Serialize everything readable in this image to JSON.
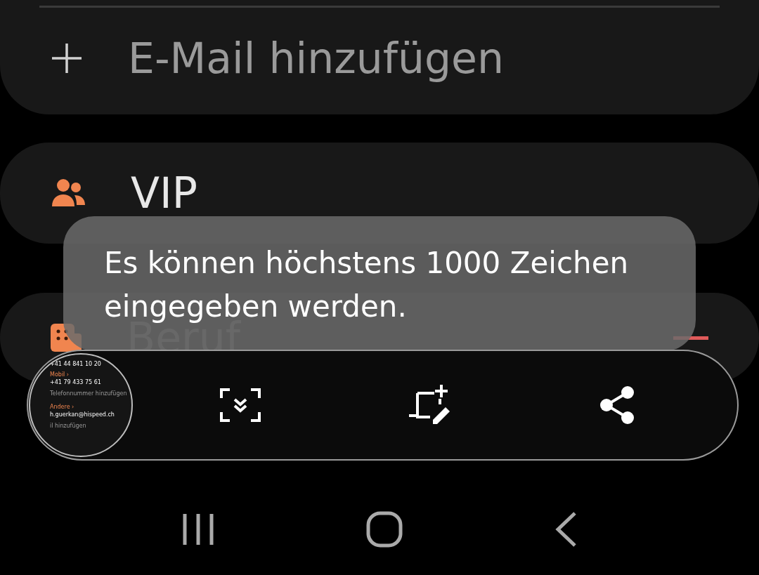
{
  "cards": [
    {
      "kind": "add",
      "label": "E-Mail hinzufügen",
      "divider": true
    },
    {
      "kind": "group",
      "label": "VIP"
    },
    {
      "kind": "work",
      "label": "Beruf"
    }
  ],
  "toast": {
    "text": "Es können höchstens 1000 Zeichen eingegeben werden."
  },
  "screenshot_preview": {
    "rows": [
      {
        "kind": "value",
        "text": "+41 44 841 10 20"
      },
      {
        "kind": "label",
        "text": "Mobil ›"
      },
      {
        "kind": "value",
        "text": "+41 79 433 75 61"
      },
      {
        "kind": "add",
        "text": "Telefonnummer hinzufügen"
      },
      {
        "kind": "label",
        "text": "Andere ›"
      },
      {
        "kind": "value",
        "text": "h.guerkan@hispeed.ch"
      },
      {
        "kind": "add",
        "text": "il hinzufügen"
      }
    ]
  },
  "toolbar": [
    {
      "kind": "scroll"
    },
    {
      "kind": "crop"
    },
    {
      "kind": "share"
    }
  ],
  "nav": [
    {
      "kind": "recents"
    },
    {
      "kind": "home"
    },
    {
      "kind": "back"
    }
  ]
}
